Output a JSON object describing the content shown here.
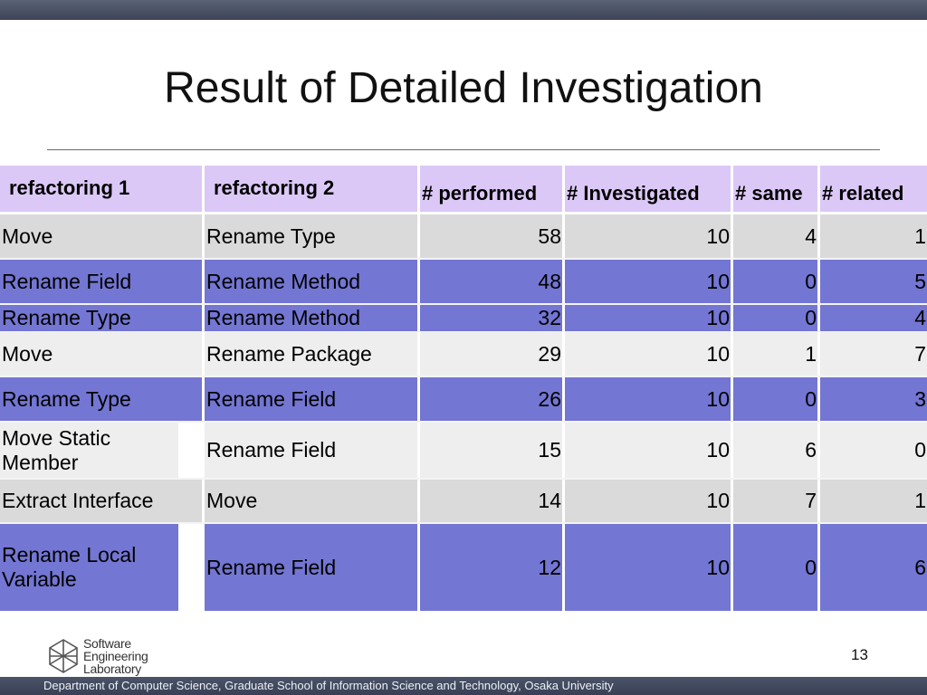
{
  "slide": {
    "title": "Result of Detailed Investigation",
    "page_number": "13",
    "footer_text": "Department of Computer Science, Graduate School of Information Science and Technology, Osaka University",
    "logo_lines": [
      "Software",
      "Engineering",
      "Laboratory"
    ]
  },
  "table": {
    "headers": [
      "refactoring 1",
      "refactoring 2",
      "# performed",
      "# Investigated",
      "# same",
      "# related"
    ],
    "rows": [
      {
        "r1": "Move",
        "r2": "Rename Type",
        "performed": "58",
        "investigated": "10",
        "same": "4",
        "related": "1"
      },
      {
        "r1": "Rename Field",
        "r2": "Rename Method",
        "performed": "48",
        "investigated": "10",
        "same": "0",
        "related": "5"
      },
      {
        "r1": "Rename Type",
        "r2": "Rename Method",
        "performed": "32",
        "investigated": "10",
        "same": "0",
        "related": "4"
      },
      {
        "r1": "Move",
        "r2": "Rename Package",
        "performed": "29",
        "investigated": "10",
        "same": "1",
        "related": "7"
      },
      {
        "r1": "Rename Type",
        "r2": "Rename Field",
        "performed": "26",
        "investigated": "10",
        "same": "0",
        "related": "3"
      },
      {
        "r1": "Move Static Member",
        "r2": "Rename Field",
        "performed": "15",
        "investigated": "10",
        "same": "6",
        "related": "0"
      },
      {
        "r1": "Extract Interface",
        "r2": "Move",
        "performed": "14",
        "investigated": "10",
        "same": "7",
        "related": "1"
      },
      {
        "r1": "Rename Local Variable",
        "r2": "Rename Field",
        "performed": "12",
        "investigated": "10",
        "same": "0",
        "related": "6"
      }
    ]
  }
}
